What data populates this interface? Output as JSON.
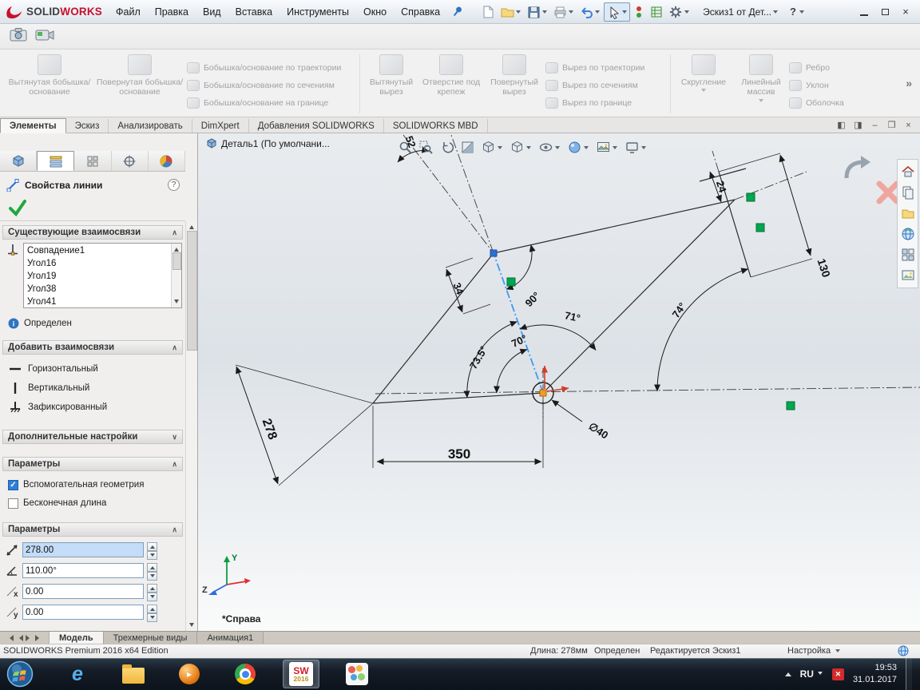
{
  "window": {
    "logo_solid": "SOLID",
    "logo_works": "WORKS",
    "doc_selector": "Эскиз1 от Дет...",
    "help": "?"
  },
  "menubar": {
    "items": [
      "Файл",
      "Правка",
      "Вид",
      "Вставка",
      "Инструменты",
      "Окно",
      "Справка"
    ]
  },
  "ribbon": {
    "large": [
      "Вытянутая бобышка/основание",
      "Повернутая бобышка/основание",
      "Вытянутый вырез",
      "Отверстие под крепеж",
      "Повернутый вырез",
      "Скругление",
      "Линейный массив"
    ],
    "stack1": [
      "Бобышка/основание по траектории",
      "Бобышка/основание по сечениям",
      "Бобышка/основание на границе"
    ],
    "stack2": [
      "Вырез по траектории",
      "Вырез по сечениям",
      "Вырез по границе"
    ],
    "stack3": [
      "Ребро",
      "Уклон",
      "Оболочка"
    ],
    "more": "»"
  },
  "doc_tabs": {
    "items": [
      "Элементы",
      "Эскиз",
      "Анализировать",
      "DimXpert",
      "Добавления SOLIDWORKS",
      "SOLIDWORKS MBD"
    ]
  },
  "property_manager": {
    "title": "Свойства линии",
    "help": "?",
    "existing_relations": {
      "title": "Существующие взаимосвязи",
      "items": [
        "Совпадение1",
        "Угол16",
        "Угол19",
        "Угол38",
        "Угол41"
      ]
    },
    "status": "Определен",
    "add_relations": {
      "title": "Добавить взаимосвязи",
      "items": [
        "Горизонтальный",
        "Вертикальный",
        "Зафиксированный"
      ]
    },
    "advanced": {
      "title": "Дополнительные настройки"
    },
    "options": {
      "title": "Параметры",
      "checkbox_construction": "Вспомогательная геометрия",
      "checkbox_infinite": "Бесконечная длина"
    },
    "parameters": {
      "title": "Параметры",
      "length": "278.00",
      "angle": "110.00°",
      "x": "0.00",
      "y": "0.00"
    }
  },
  "viewport": {
    "feature_tree_item": "Деталь1  (По умолчани...",
    "view_label": "*Справа",
    "triad_y": "Y",
    "triad_z": "Z",
    "dims": {
      "d350": "350",
      "d278": "278",
      "d34": "34",
      "d24": "24",
      "d130": "130",
      "d52": "52",
      "dia40": "∅40",
      "a90": "90°",
      "a71": "71°",
      "a74": "74°",
      "a735": "73.5°",
      "a70": "70°"
    }
  },
  "model_tabs": {
    "items": [
      "Модель",
      "Трехмерные виды",
      "Анимация1"
    ]
  },
  "statusbar": {
    "edition": "SOLIDWORKS Premium 2016 x64 Edition",
    "length": "Длина: 278мм",
    "state": "Определен",
    "editing": "Редактируется Эскиз1",
    "custom_menu": "Настройка"
  },
  "taskbar": {
    "language": "RU",
    "time": "19:53",
    "date": "31.01.2017",
    "sw_label": "SW",
    "sw_year": "2016"
  }
}
